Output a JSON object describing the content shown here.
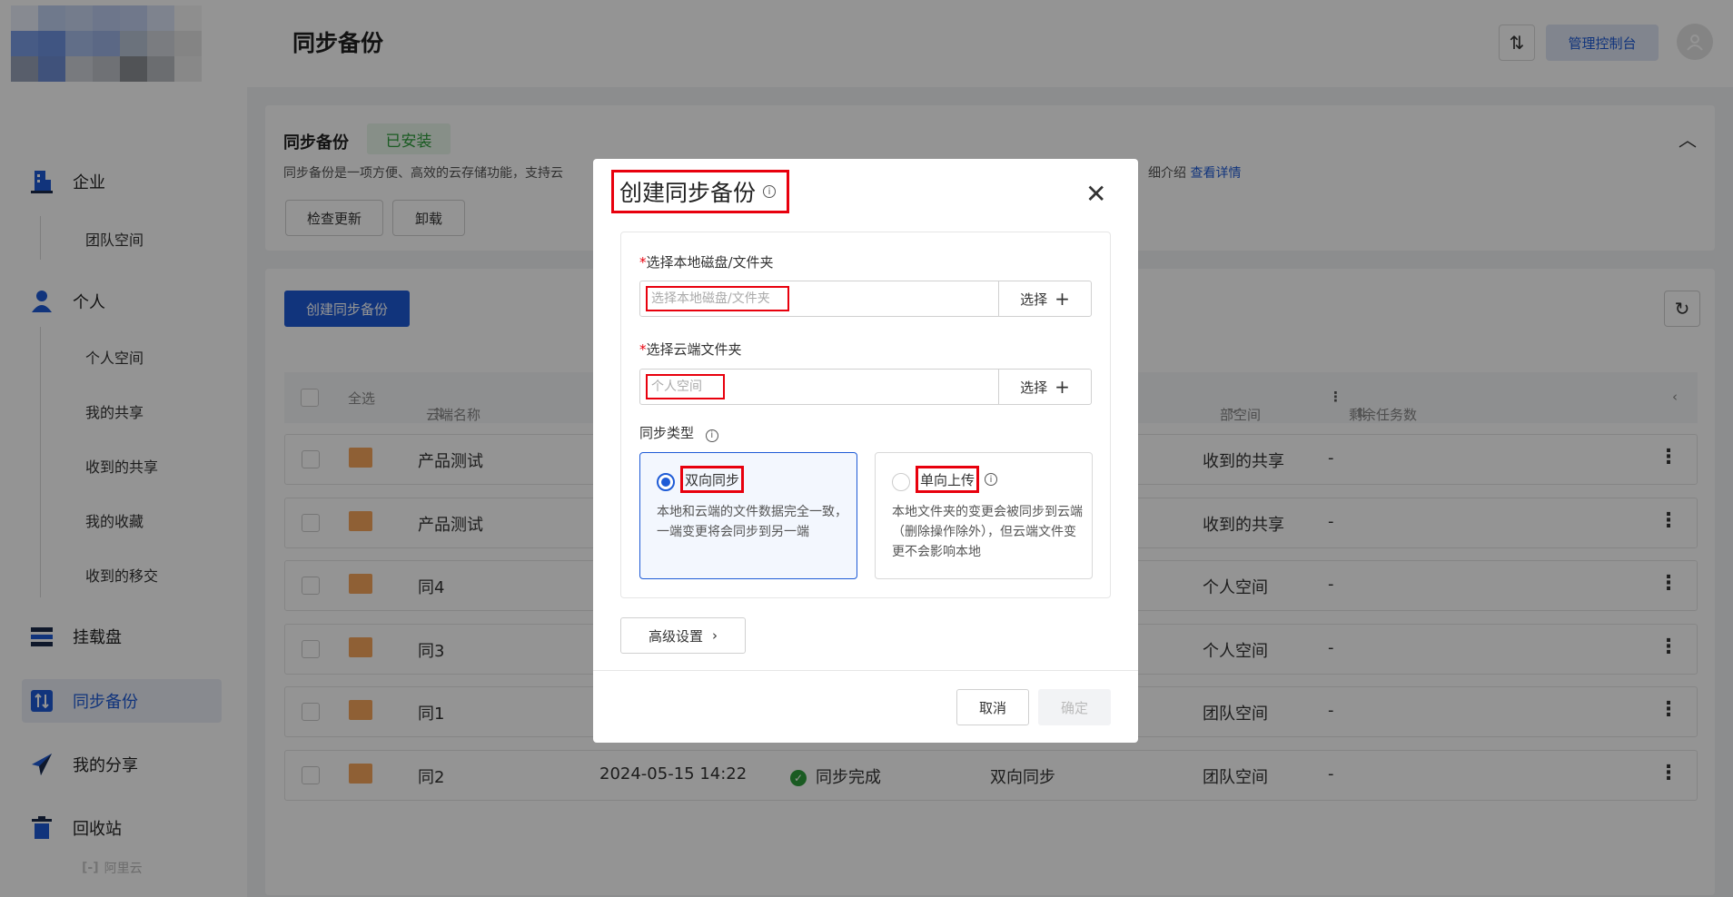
{
  "header": {
    "title": "同步备份",
    "console_label": "管理控制台"
  },
  "sidebar": {
    "groups": [
      {
        "label": "企业",
        "icon": "building-icon",
        "children": [
          "团队空间"
        ]
      },
      {
        "label": "个人",
        "icon": "user-icon",
        "children": [
          "个人空间",
          "我的共享",
          "收到的共享",
          "我的收藏",
          "收到的移交"
        ]
      }
    ],
    "items": [
      {
        "label": "挂载盘",
        "icon": "mount-disk-icon"
      },
      {
        "label": "同步备份",
        "icon": "sync-backup-icon",
        "active": true
      },
      {
        "label": "我的分享",
        "icon": "share-plane-icon"
      },
      {
        "label": "回收站",
        "icon": "trash-icon"
      }
    ],
    "footer_brand": "阿里云"
  },
  "info_card": {
    "title": "同步备份",
    "status_badge": "已安装",
    "description_left": "同步备份是一项方便、高效的云存储功能，支持云",
    "description_right": "细介绍",
    "details_link": "查看详情",
    "check_update_label": "检查更新",
    "uninstall_label": "卸载"
  },
  "main": {
    "create_label": "创建同步备份",
    "columns": {
      "select_all": "全选",
      "name": "云端名称",
      "space": "部空间",
      "remaining": "剩余任务数"
    },
    "rows": [
      {
        "name": "产品测试",
        "time": "",
        "status": "",
        "type": "",
        "space": "收到的共享",
        "remaining": "-"
      },
      {
        "name": "产品测试",
        "time": "",
        "status": "",
        "type": "",
        "space": "收到的共享",
        "remaining": "-"
      },
      {
        "name": "同4",
        "time": "",
        "status": "",
        "type": "",
        "space": "个人空间",
        "remaining": "-"
      },
      {
        "name": "同3",
        "time": "",
        "status": "",
        "type": "",
        "space": "个人空间",
        "remaining": "-"
      },
      {
        "name": "同1",
        "time": "",
        "status": "",
        "type": "",
        "space": "团队空间",
        "remaining": "-"
      },
      {
        "name": "同2",
        "time": "2024-05-15 14:22",
        "status": "同步完成",
        "type": "双向同步",
        "space": "团队空间",
        "remaining": "-"
      }
    ]
  },
  "modal": {
    "title": "创建同步备份",
    "local_label_req": "*",
    "local_label": "选择本地磁盘/文件夹",
    "local_placeholder": "选择本地磁盘/文件夹",
    "choose_label": "选择",
    "cloud_label_req": "*",
    "cloud_label": "选择云端文件夹",
    "cloud_value": "个人空间",
    "sync_type_label": "同步类型",
    "options": [
      {
        "title": "双向同步",
        "desc": "本地和云端的文件数据完全一致，一端变更将会同步到另一端",
        "selected": true
      },
      {
        "title": "单向上传",
        "desc": "本地文件夹的变更会被同步到云端（删除操作除外），但云端文件变更不会影响本地",
        "selected": false
      }
    ],
    "advanced_label": "高级设置",
    "cancel_label": "取消",
    "confirm_label": "确定"
  },
  "colors": {
    "primary": "#1e5bd6",
    "highlight_box": "#e8000d",
    "success": "#2e9d3c"
  }
}
